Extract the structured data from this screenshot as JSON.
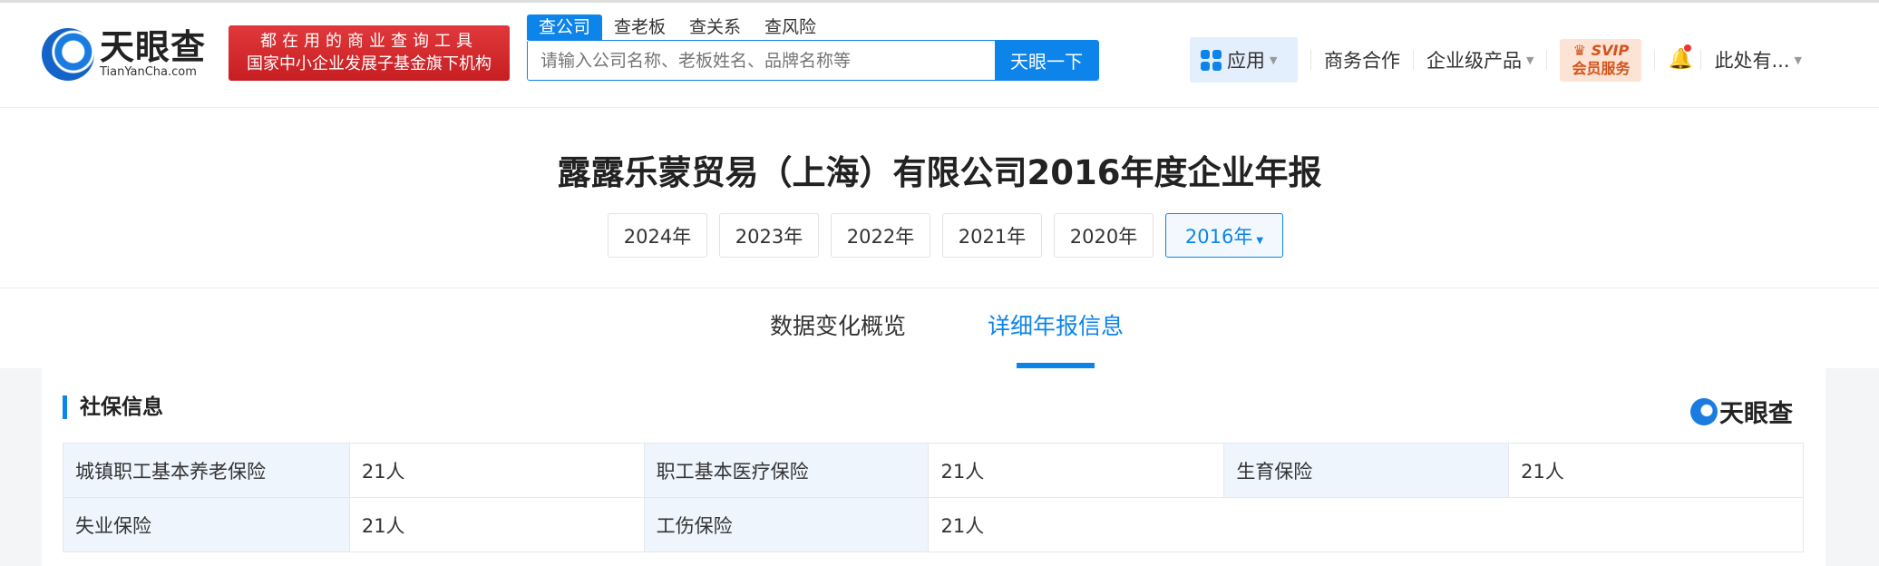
{
  "header": {
    "logo_cn": "天眼查",
    "logo_en": "TianYanCha.com",
    "banner_line1": "都在用的商业查询工具",
    "banner_line2": "国家中小企业发展子基金旗下机构",
    "search_tabs": [
      "查公司",
      "查老板",
      "查关系",
      "查风险"
    ],
    "search_placeholder": "请输入公司名称、老板姓名、品牌名称等",
    "search_button": "天眼一下",
    "nav": {
      "app": "应用",
      "business": "商务合作",
      "enterprise": "企业级产品",
      "svip_top": "SVIP",
      "svip_bottom": "会员服务",
      "user": "此处有..."
    }
  },
  "title": "露露乐蒙贸易（上海）有限公司2016年度企业年报",
  "years": [
    "2024年",
    "2023年",
    "2022年",
    "2021年",
    "2020年",
    "2016年"
  ],
  "tabs": [
    "数据变化概览",
    "详细年报信息"
  ],
  "section": {
    "title": "社保信息",
    "watermark": "天眼查",
    "rows": [
      [
        {
          "k": "城镇职工基本养老保险",
          "v": "21人"
        },
        {
          "k": "职工基本医疗保险",
          "v": "21人"
        },
        {
          "k": "生育保险",
          "v": "21人"
        }
      ],
      [
        {
          "k": "失业保险",
          "v": "21人"
        },
        {
          "k": "工伤保险",
          "v": "21人"
        }
      ]
    ]
  },
  "colors": {
    "accent": "#0d84ea",
    "banner": "#d62a2e"
  }
}
